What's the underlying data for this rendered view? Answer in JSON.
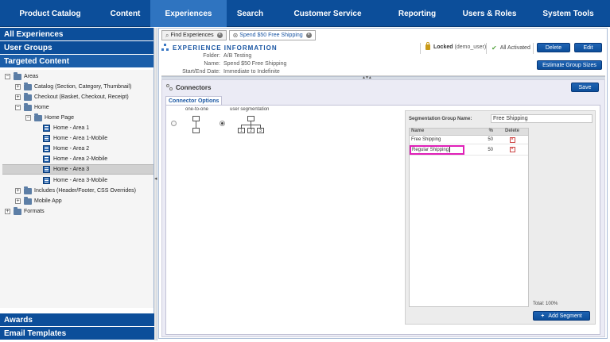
{
  "topnav": {
    "items": [
      {
        "label": "Product Catalog"
      },
      {
        "label": "Content"
      },
      {
        "label": "Experiences",
        "active": true
      },
      {
        "label": "Search"
      },
      {
        "label": "Customer Service"
      },
      {
        "label": "Reporting"
      },
      {
        "label": "Users & Roles"
      },
      {
        "label": "System Tools"
      }
    ]
  },
  "sidebar": {
    "sections_top": [
      "All Experiences",
      "User Groups",
      "Targeted Content"
    ],
    "tree": [
      {
        "label": "Areas",
        "expander": "−",
        "icon": "folder"
      },
      {
        "label": "Catalog (Section, Category, Thumbnail)",
        "expander": "+",
        "icon": "folder"
      },
      {
        "label": "Checkout (Basket, Checkout, Receipt)",
        "expander": "+",
        "icon": "folder"
      },
      {
        "label": "Home",
        "expander": "−",
        "icon": "folder"
      },
      {
        "label": "Home Page",
        "expander": "−",
        "icon": "folder"
      },
      {
        "label": "Home - Area 1",
        "icon": "page"
      },
      {
        "label": "Home - Area 1-Mobile",
        "icon": "page"
      },
      {
        "label": "Home - Area 2",
        "icon": "page"
      },
      {
        "label": "Home - Area 2-Mobile",
        "icon": "page"
      },
      {
        "label": "Home - Area 3",
        "icon": "page",
        "selected": true
      },
      {
        "label": "Home - Area 3-Mobile",
        "icon": "page"
      },
      {
        "label": "Includes (Header/Footer, CSS Overrides)",
        "expander": "+",
        "icon": "folder"
      },
      {
        "label": "Mobile App",
        "expander": "+",
        "icon": "folder"
      },
      {
        "label": "Formats",
        "expander": "+",
        "icon": "folder"
      }
    ],
    "sections_bottom": [
      "Awards",
      "Email Templates"
    ]
  },
  "tabs": [
    {
      "label": "Find Experiences"
    },
    {
      "label": "Spend $50 Free Shipping",
      "active": true
    }
  ],
  "experience_info": {
    "title": "EXPERIENCE INFORMATION",
    "folder_label": "Folder:",
    "folder_value": "A/B Testing",
    "name_label": "Name:",
    "name_value": "Spend $50 Free Shipping",
    "dates_label": "Start/End Date:",
    "dates_value": "Immediate to Indefinite",
    "locked_label": "Locked",
    "locked_user": "(demo_user)",
    "activated_label": "All Activated",
    "delete_button": "Delete",
    "edit_button": "Edit",
    "estimate_button": "Estimate Group Sizes"
  },
  "connectors": {
    "title": "Connectors",
    "save_button": "Save",
    "subtab": "Connector Options",
    "option_one_to_one": "one-to-one",
    "option_user_segmentation": "user segmentation",
    "selected_option": "user segmentation",
    "diagram_numbers": [
      "1",
      "2",
      "3"
    ]
  },
  "segmentation": {
    "group_name_label": "Segmentation Group Name:",
    "group_name_value": "Free Shipping",
    "columns": {
      "name": "Name",
      "pct": "%",
      "del": "Delete"
    },
    "rows": [
      {
        "name": "Free Shipping",
        "pct": "50"
      },
      {
        "name": "Regular Shipping",
        "pct": "50",
        "editing": true
      }
    ],
    "total": "Total: 100%",
    "add_button": "Add Segment",
    "highlight_color": "#e01fb8"
  }
}
